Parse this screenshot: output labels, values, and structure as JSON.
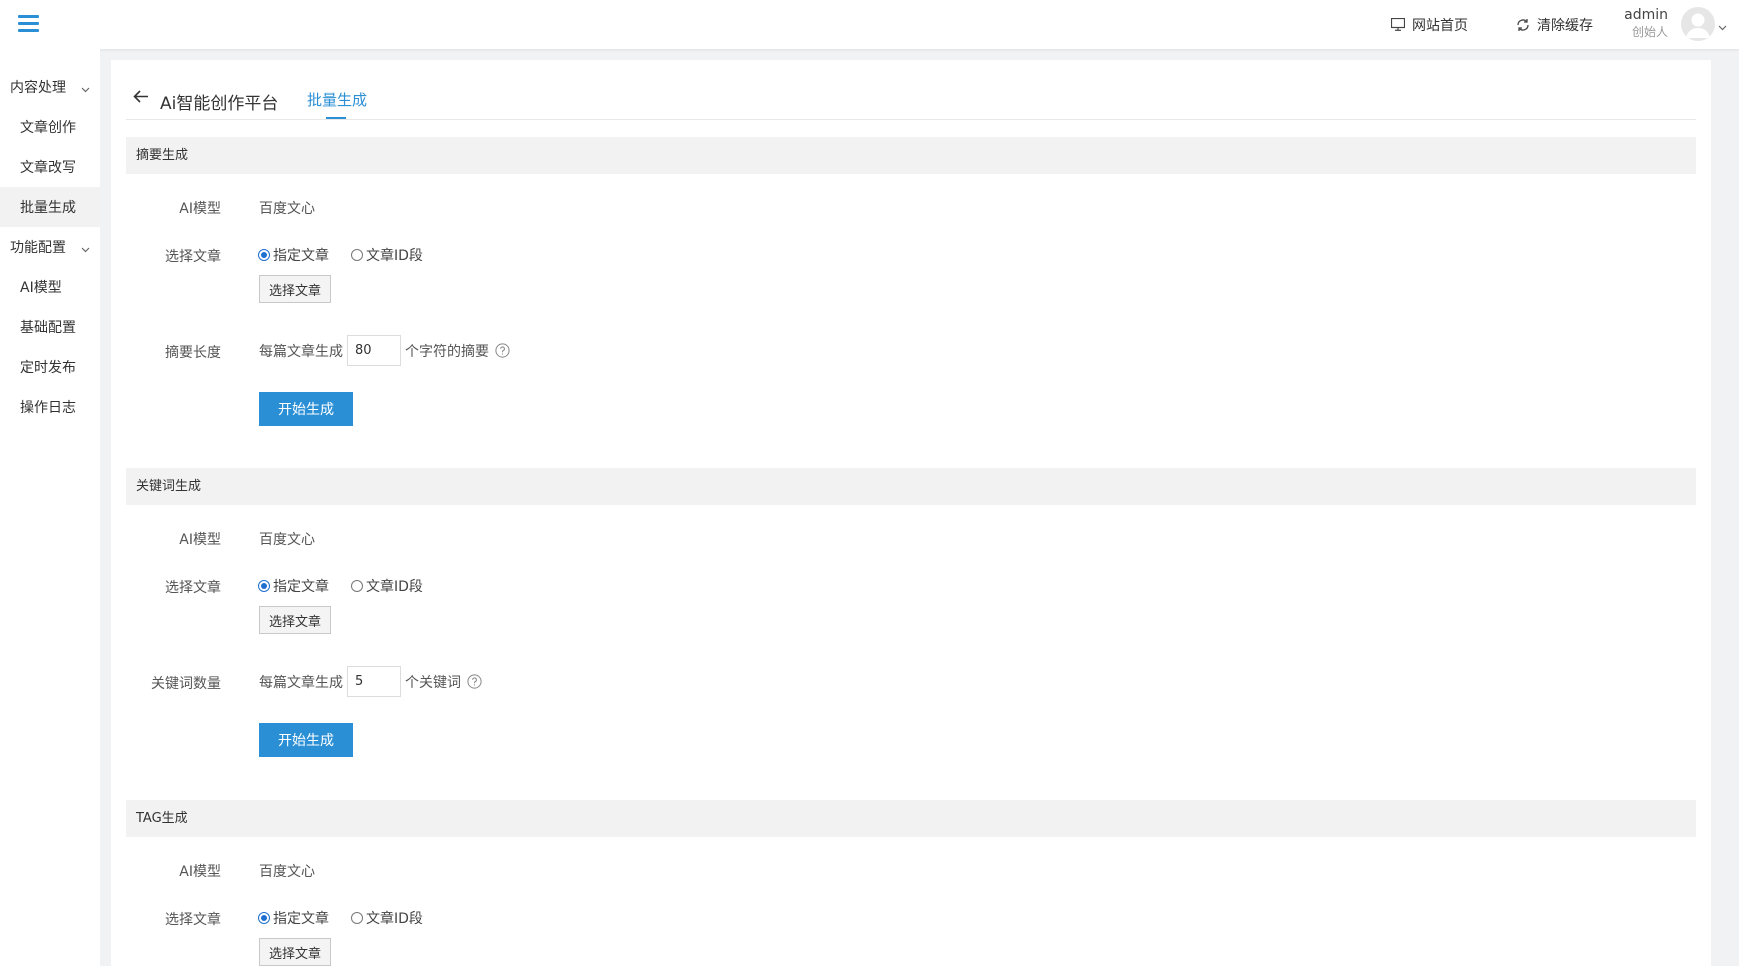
{
  "topbar": {
    "site_home": "网站首页",
    "clear_cache": "清除缓存",
    "user_name": "admin",
    "user_role": "创始人"
  },
  "sidebar": {
    "groups": [
      {
        "label": "内容处理",
        "items": [
          "文章创作",
          "文章改写",
          "批量生成"
        ]
      },
      {
        "label": "功能配置",
        "items": [
          "AI模型",
          "基础配置",
          "定时发布",
          "操作日志"
        ]
      }
    ],
    "active_item": "批量生成"
  },
  "header": {
    "title": "Ai智能创作平台",
    "active_tab": "批量生成"
  },
  "sections": [
    {
      "title": "摘要生成",
      "model_label": "AI模型",
      "model_value": "百度文心",
      "select_label": "选择文章",
      "radio_options": [
        "指定文章",
        "文章ID段"
      ],
      "radio_selected": "指定文章",
      "pick_button": "选择文章",
      "param_label": "摘要长度",
      "param_prefix": "每篇文章生成",
      "param_value": "80",
      "param_suffix": "个字符的摘要",
      "submit": "开始生成"
    },
    {
      "title": "关键词生成",
      "model_label": "AI模型",
      "model_value": "百度文心",
      "select_label": "选择文章",
      "radio_options": [
        "指定文章",
        "文章ID段"
      ],
      "radio_selected": "指定文章",
      "pick_button": "选择文章",
      "param_label": "关键词数量",
      "param_prefix": "每篇文章生成",
      "param_value": "5",
      "param_suffix": "个关键词",
      "submit": "开始生成"
    },
    {
      "title": "TAG生成",
      "model_label": "AI模型",
      "model_value": "百度文心",
      "select_label": "选择文章",
      "radio_options": [
        "指定文章",
        "文章ID段"
      ],
      "radio_selected": "指定文章",
      "pick_button": "选择文章"
    }
  ],
  "colors": {
    "accent": "#2b8fd6",
    "section_bg": "#f2f2f2",
    "page_bg": "#f1f2f4"
  }
}
